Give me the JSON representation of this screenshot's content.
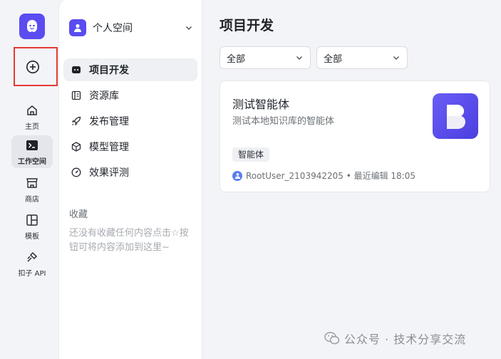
{
  "rail": {
    "items": [
      {
        "label": "主页",
        "icon": "home-icon"
      },
      {
        "label": "工作空间",
        "icon": "terminal-icon"
      },
      {
        "label": "商店",
        "icon": "store-icon"
      },
      {
        "label": "模板",
        "icon": "template-icon"
      },
      {
        "label": "扣子 API",
        "icon": "api-icon"
      }
    ]
  },
  "panel": {
    "space_name": "个人空间",
    "nav": [
      {
        "label": "项目开发",
        "icon": "project-icon"
      },
      {
        "label": "资源库",
        "icon": "library-icon"
      },
      {
        "label": "发布管理",
        "icon": "rocket-icon"
      },
      {
        "label": "模型管理",
        "icon": "model-icon"
      },
      {
        "label": "效果评测",
        "icon": "gauge-icon"
      }
    ],
    "favorites_title": "收藏",
    "favorites_empty": "还没有收藏任何内容点击☆按钮可将内容添加到这里~"
  },
  "main": {
    "title": "项目开发",
    "filters": [
      "全部",
      "全部"
    ],
    "card": {
      "title": "测试智能体",
      "description": "测试本地知识库的智能体",
      "tag": "智能体",
      "meta": "RootUser_2103942205 • 最近编辑 18:05"
    }
  },
  "watermark": "公众号 · 技术分享交流",
  "colors": {
    "accent": "#5a4cf0",
    "highlight_box": "#e53935"
  }
}
